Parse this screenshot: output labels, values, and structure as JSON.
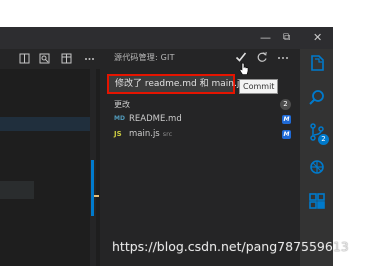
{
  "titlebar": {
    "minimize_glyph": "—",
    "restore_glyph": "⧉",
    "close_glyph": "✕"
  },
  "editor_toolbar": {
    "icons": [
      "split-editor-icon",
      "search-icon",
      "layout-icon",
      "more-icon"
    ]
  },
  "scm": {
    "title": "源代码管理: GIT",
    "commit_tooltip": "Commit",
    "message_value": "修改了 readme.md 和 main.js",
    "changes_header": "更改",
    "changes_count": "2",
    "files": [
      {
        "icon_label": "MD",
        "icon_color": "#519aba",
        "name": "README.md",
        "dir": "",
        "status": "M"
      },
      {
        "icon_label": "JS",
        "icon_color": "#cbcb41",
        "name": "main.js",
        "dir": "src",
        "status": "M"
      }
    ]
  },
  "activity_bar": {
    "items": [
      "explorer-icon",
      "search-icon",
      "source-control-icon",
      "debug-icon",
      "extensions-icon"
    ],
    "scm_badge": "2"
  },
  "colors": {
    "accent": "#007acc",
    "highlight_border": "#e51400",
    "modified_badge": "#1f6ad6"
  },
  "watermark": "https://blog.csdn.net/pang787559613"
}
